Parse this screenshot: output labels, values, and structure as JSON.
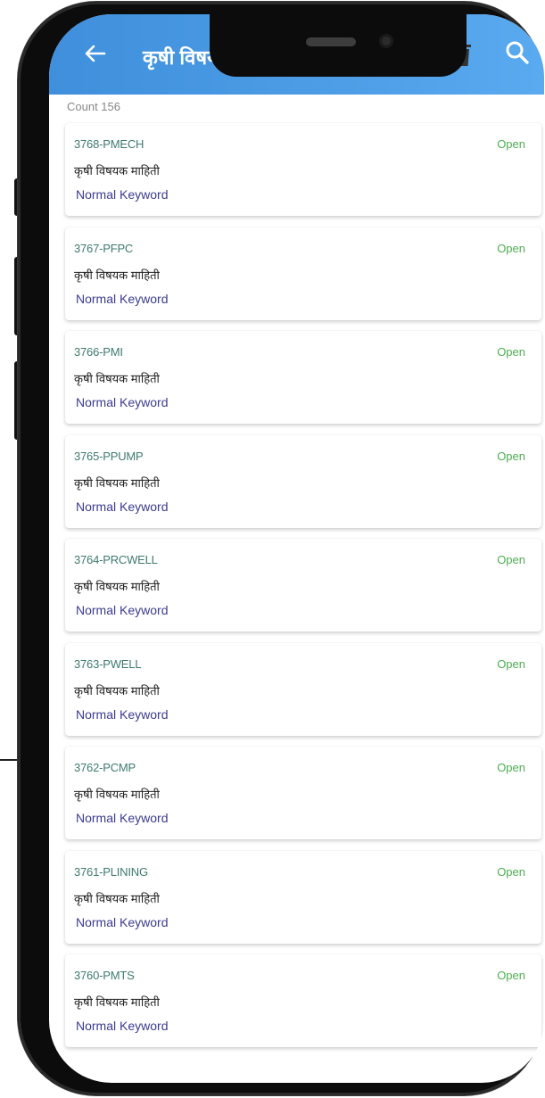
{
  "appbar": {
    "title": "कृषी विषयक माहिती",
    "back_icon": "arrow-left-icon",
    "trash_icon": "trash-icon",
    "search_icon": "search-icon",
    "color": "#4d9ee6"
  },
  "count_label": "Count 156",
  "colors": {
    "status_open": "#4caf50",
    "code": "#3d7a6e",
    "keyword": "#3b3b8f"
  },
  "items": [
    {
      "code": "3768-PMECH",
      "subject": "कृषी विषयक माहिती",
      "keyword": "Normal Keyword",
      "status": "Open"
    },
    {
      "code": "3767-PFPC",
      "subject": "कृषी विषयक माहिती",
      "keyword": "Normal Keyword",
      "status": "Open"
    },
    {
      "code": "3766-PMI",
      "subject": "कृषी विषयक माहिती",
      "keyword": "Normal Keyword",
      "status": "Open"
    },
    {
      "code": "3765-PPUMP",
      "subject": "कृषी विषयक माहिती",
      "keyword": "Normal Keyword",
      "status": "Open"
    },
    {
      "code": "3764-PRCWELL",
      "subject": "कृषी विषयक माहिती",
      "keyword": "Normal Keyword",
      "status": "Open"
    },
    {
      "code": "3763-PWELL",
      "subject": "कृषी विषयक माहिती",
      "keyword": "Normal Keyword",
      "status": "Open"
    },
    {
      "code": "3762-PCMP",
      "subject": "कृषी विषयक माहिती",
      "keyword": "Normal Keyword",
      "status": "Open"
    },
    {
      "code": "3761-PLINING",
      "subject": "कृषी विषयक माहिती",
      "keyword": "Normal Keyword",
      "status": "Open"
    },
    {
      "code": "3760-PMTS",
      "subject": "कृषी विषयक माहिती",
      "keyword": "Normal Keyword",
      "status": "Open"
    }
  ]
}
